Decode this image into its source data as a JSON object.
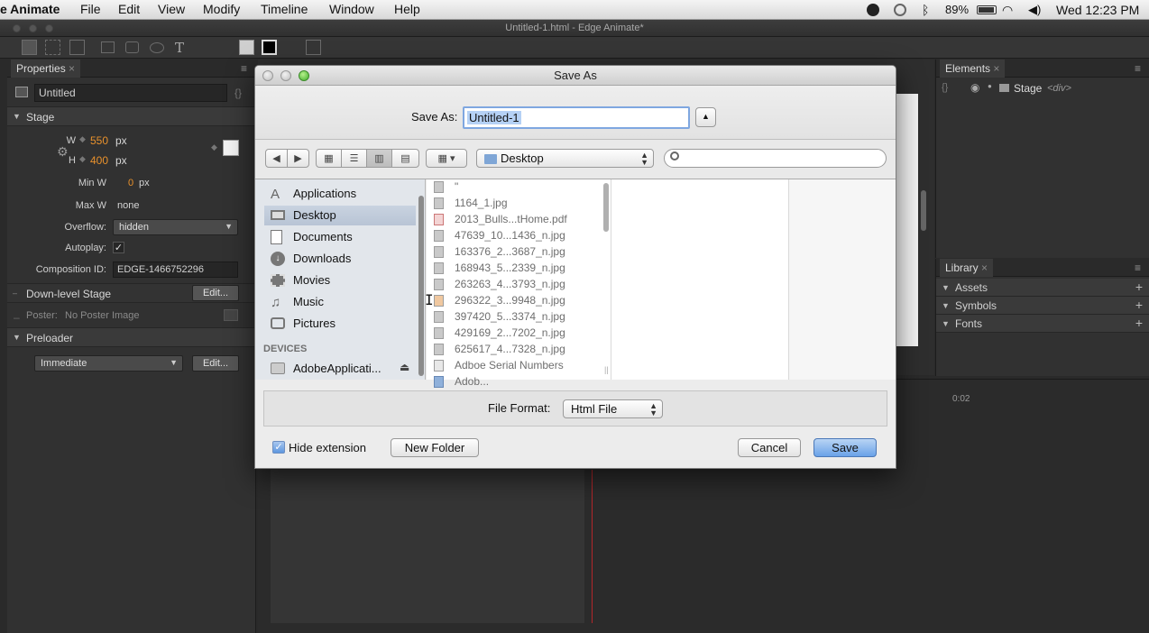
{
  "menubar": {
    "app": "e Animate",
    "items": [
      "File",
      "Edit",
      "View",
      "Modify",
      "Timeline",
      "Window",
      "Help"
    ],
    "battery": "89%",
    "clock": "Wed 12:23 PM"
  },
  "window": {
    "title": "Untitled-1.html - Edge Animate*"
  },
  "properties": {
    "tab": "Properties",
    "name": "Untitled",
    "stage_section": "Stage",
    "w_label": "W",
    "w_value": "550",
    "h_label": "H",
    "h_value": "400",
    "unit": "px",
    "minw_label": "Min W",
    "minw_value": "0",
    "maxw_label": "Max W",
    "maxw_value": "none",
    "overflow_label": "Overflow:",
    "overflow_value": "hidden",
    "autoplay_label": "Autoplay:",
    "autoplay_check": "✓",
    "compid_label": "Composition ID:",
    "compid_value": "EDGE-1466752296",
    "downlevel_label": "Down-level Stage",
    "edit_label": "Edit...",
    "poster_label": "Poster:",
    "poster_value": "No Poster Image",
    "preloader_section": "Preloader",
    "preloader_value": "Immediate"
  },
  "elements": {
    "tab": "Elements",
    "stage": "Stage",
    "stage_tag": "<div>"
  },
  "library": {
    "tab": "Library",
    "sections": [
      "Assets",
      "Symbols",
      "Fonts"
    ]
  },
  "timeline": {
    "time_label": "0:02"
  },
  "dialog": {
    "title": "Save As",
    "save_as_label": "Save As:",
    "filename": "Untitled-1",
    "location": "Desktop",
    "sidebar_favorites": [
      "Applications",
      "Desktop",
      "Documents",
      "Downloads",
      "Movies",
      "Music",
      "Pictures"
    ],
    "devices_header": "DEVICES",
    "device": "AdobeApplicati...",
    "files": [
      "\"",
      "1164_1.jpg",
      "2013_Bulls...tHome.pdf",
      "47639_10...1436_n.jpg",
      "163376_2...3687_n.jpg",
      "168943_5...2339_n.jpg",
      "263263_4...3793_n.jpg",
      "296322_3...9948_n.jpg",
      "397420_5...3374_n.jpg",
      "429169_2...7202_n.jpg",
      "625617_4...7328_n.jpg",
      "Adboe Serial Numbers",
      "Adob..."
    ],
    "file_format_label": "File Format:",
    "file_format_value": "Html File",
    "hide_extension_label": "Hide extension",
    "new_folder_label": "New Folder",
    "cancel_label": "Cancel",
    "save_label": "Save"
  }
}
